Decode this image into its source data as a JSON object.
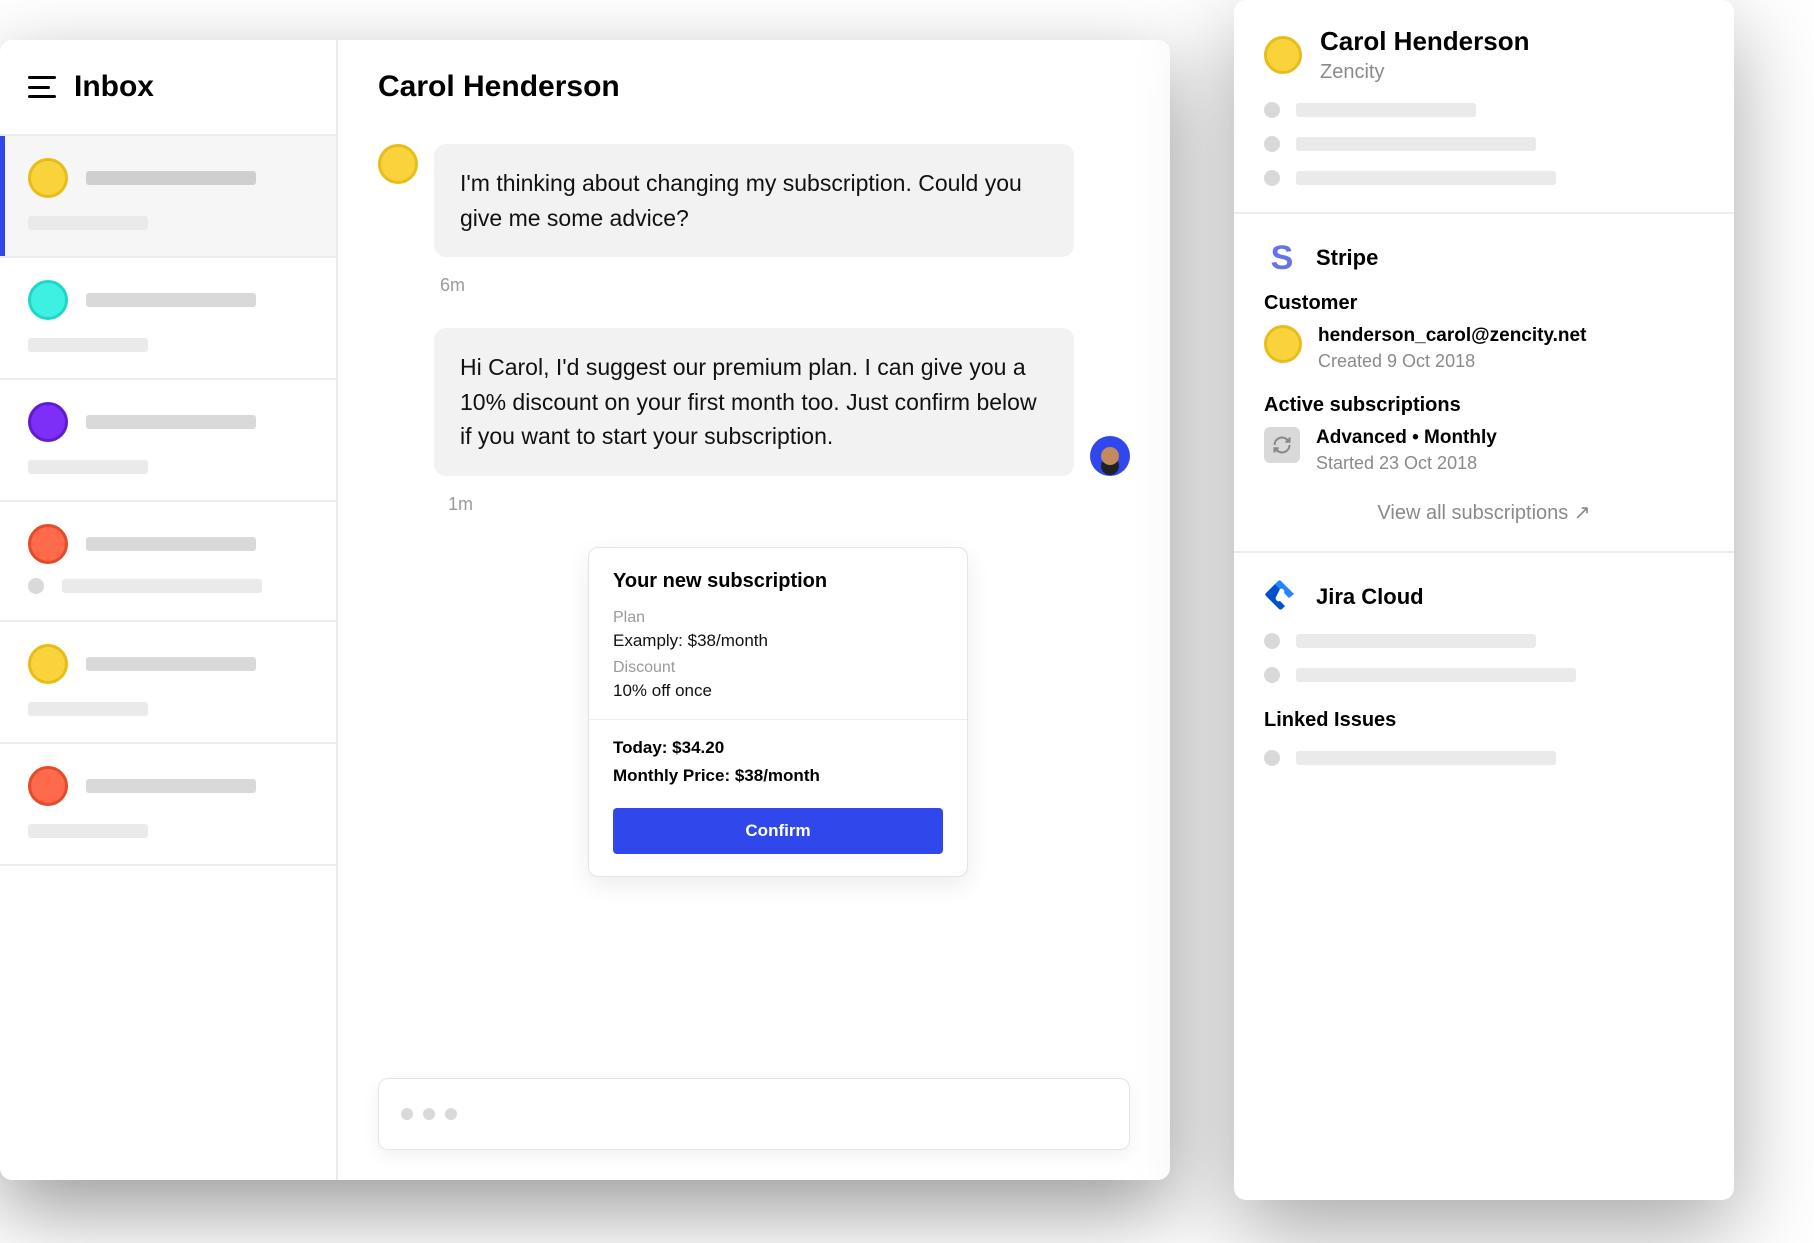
{
  "sidebar": {
    "title": "Inbox",
    "items": [
      {
        "color": "yellow",
        "active": true
      },
      {
        "color": "cyan"
      },
      {
        "color": "purple"
      },
      {
        "color": "orange"
      },
      {
        "color": "yellow"
      },
      {
        "color": "orange"
      }
    ]
  },
  "conversation": {
    "title": "Carol Henderson",
    "messages": [
      {
        "from": "customer",
        "text": "I'm thinking about changing my subscription. Could you give me some advice?",
        "time": "6m"
      },
      {
        "from": "agent",
        "text": "Hi Carol, I'd suggest our premium plan. I can give you a 10% discount on your first month too. Just confirm below if you want to start your subscription.",
        "time": "1m"
      }
    ],
    "card": {
      "title": "Your new subscription",
      "plan_label": "Plan",
      "plan_value": "Examply: $38/month",
      "discount_label": "Discount",
      "discount_value": "10% off once",
      "today": "Today: $34.20",
      "monthly": "Monthly Price: $38/month",
      "confirm": "Confirm"
    }
  },
  "panel": {
    "contact": {
      "name": "Carol Henderson",
      "company": "Zencity"
    },
    "stripe": {
      "title": "Stripe",
      "customer_label": "Customer",
      "customer_email": "henderson_carol@zencity.net",
      "customer_created": "Created 9 Oct 2018",
      "subs_label": "Active subscriptions",
      "sub_name": "Advanced • Monthly",
      "sub_started": "Started 23 Oct 2018",
      "view_all": "View all subscriptions ↗"
    },
    "jira": {
      "title": "Jira Cloud",
      "linked_label": "Linked Issues"
    }
  }
}
